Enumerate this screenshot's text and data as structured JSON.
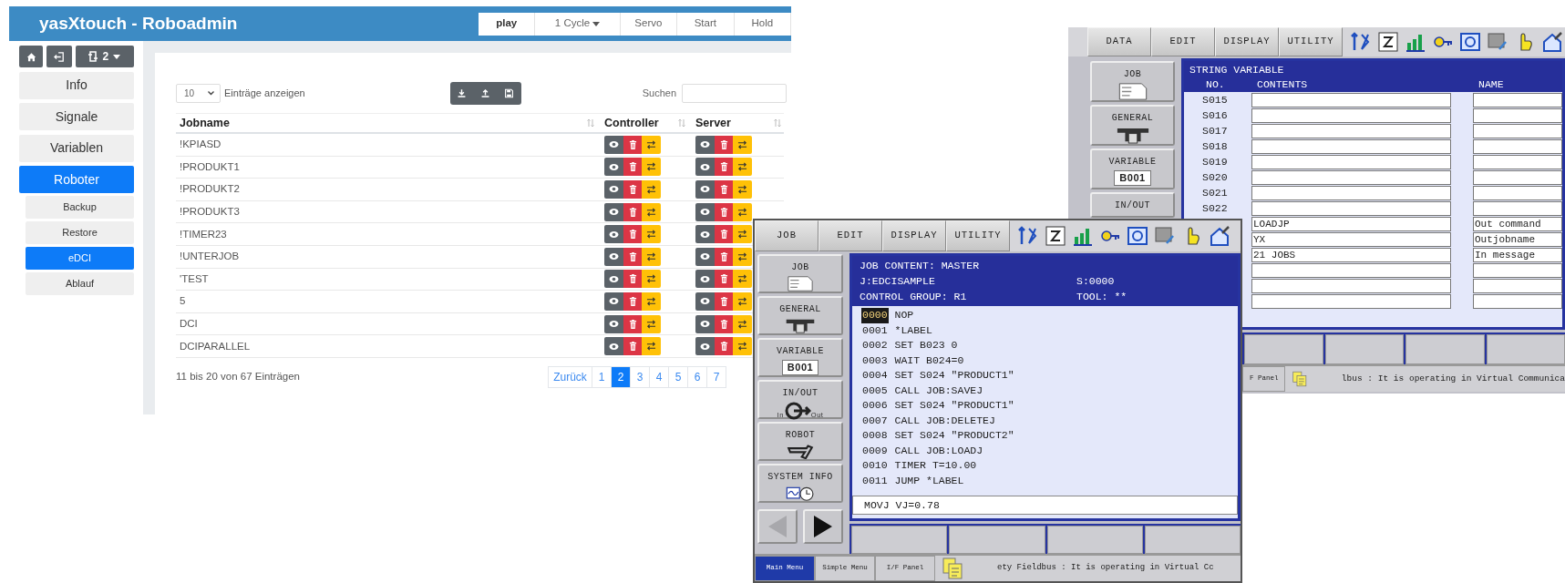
{
  "web_app": {
    "title": "yasXtouch - Roboadmin",
    "header_buttons": [
      {
        "label": "play",
        "selected": true,
        "kind": "button"
      },
      {
        "label": "1 Cycle",
        "selected": false,
        "kind": "dropdown"
      },
      {
        "label": "Servo",
        "selected": false,
        "kind": "button"
      },
      {
        "label": "Start",
        "selected": false,
        "kind": "button"
      },
      {
        "label": "Hold",
        "selected": false,
        "kind": "button"
      }
    ],
    "robot_selector": "2",
    "nav": [
      {
        "label": "Info",
        "selected": false
      },
      {
        "label": "Signale",
        "selected": false
      },
      {
        "label": "Variablen",
        "selected": false
      },
      {
        "label": "Roboter",
        "selected": true,
        "children": [
          {
            "label": "Backup",
            "selected": false
          },
          {
            "label": "Restore",
            "selected": false
          },
          {
            "label": "eDCI",
            "selected": true
          },
          {
            "label": "Ablauf",
            "selected": false
          }
        ]
      }
    ],
    "page_length": {
      "value": "10",
      "label": "Einträge anzeigen"
    },
    "search": {
      "label": "Suchen"
    },
    "columns": [
      "Jobname",
      "Controller",
      "Server"
    ],
    "rows": [
      {
        "jobname": "!KPIASD"
      },
      {
        "jobname": "!PRODUKT1"
      },
      {
        "jobname": "!PRODUKT2"
      },
      {
        "jobname": "!PRODUKT3"
      },
      {
        "jobname": "!TIMER23"
      },
      {
        "jobname": "!UNTERJOB"
      },
      {
        "jobname": "'TEST"
      },
      {
        "jobname": "5"
      },
      {
        "jobname": "DCI"
      },
      {
        "jobname": "DCIPARALLEL"
      }
    ],
    "info": "11 bis 20 von 67 Einträgen",
    "pages": [
      {
        "label": "Zurück",
        "selected": false
      },
      {
        "label": "1",
        "selected": false
      },
      {
        "label": "2",
        "selected": true
      },
      {
        "label": "3",
        "selected": false
      },
      {
        "label": "4",
        "selected": false
      },
      {
        "label": "5",
        "selected": false
      },
      {
        "label": "6",
        "selected": false
      },
      {
        "label": "7",
        "selected": false
      }
    ]
  },
  "pendant_back": {
    "menu": [
      "DATA",
      "EDIT",
      "DISPLAY",
      "UTILITY"
    ],
    "side_buttons": [
      {
        "label": "JOB",
        "kind": "job"
      },
      {
        "label": "GENERAL",
        "kind": "general"
      },
      {
        "label": "VARIABLE",
        "kind": "variable",
        "value": "B001"
      },
      {
        "label": "IN/OUT",
        "kind": "inout"
      }
    ],
    "title": "STRING VARIABLE",
    "columns": [
      "NO.",
      "CONTENTS",
      "NAME"
    ],
    "rows": [
      {
        "number": "S015"
      },
      {
        "number": "S016"
      },
      {
        "number": "S017"
      },
      {
        "number": "S018"
      },
      {
        "number": "S019"
      },
      {
        "number": "S020"
      },
      {
        "number": "S021"
      },
      {
        "number": "S022"
      },
      {
        "contents": "LOADJP",
        "name": "Out command"
      },
      {
        "contents": "YX",
        "name": "Outjobname"
      },
      {
        "contents": "21 JOBS",
        "name": "In message"
      },
      {},
      {},
      {}
    ],
    "status_tabs": [
      {
        "label": "F Panel",
        "selected": false
      }
    ],
    "status_text": "lbus : It is operating in Virtual Communica"
  },
  "pendant_front": {
    "menu": [
      "JOB",
      "EDIT",
      "DISPLAY",
      "UTILITY"
    ],
    "side_buttons": [
      {
        "label": "JOB",
        "kind": "job"
      },
      {
        "label": "GENERAL",
        "kind": "general"
      },
      {
        "label": "VARIABLE",
        "kind": "variable",
        "value": "B001"
      },
      {
        "label": "IN/OUT",
        "kind": "inout",
        "in_label": "In",
        "out_label": "Out"
      },
      {
        "label": "ROBOT",
        "kind": "robot"
      },
      {
        "label": "SYSTEM INFO",
        "kind": "sysinfo"
      }
    ],
    "arrows": {
      "back_enabled": false,
      "forward_enabled": true
    },
    "header": [
      {
        "left": "JOB CONTENT: MASTER"
      },
      {
        "left": "J:EDCISAMPLE",
        "right": "S:0000"
      },
      {
        "left": "CONTROL GROUP: R1",
        "right": "TOOL: **"
      }
    ],
    "lines": [
      {
        "number": "0000",
        "text": "NOP",
        "selected": true
      },
      {
        "number": "0001",
        "text": "*LABEL",
        "selected": false
      },
      {
        "number": "0002",
        "text": "SET B023 0",
        "selected": false
      },
      {
        "number": "0003",
        "text": "WAIT B024=0",
        "selected": false
      },
      {
        "number": "0004",
        "text": "SET S024 \"PRODUCT1\"",
        "selected": false
      },
      {
        "number": "0005",
        "text": "CALL JOB:SAVEJ",
        "selected": false
      },
      {
        "number": "0006",
        "text": "SET S024 \"PRODUCT1\"",
        "selected": false
      },
      {
        "number": "0007",
        "text": "CALL JOB:DELETEJ",
        "selected": false
      },
      {
        "number": "0008",
        "text": "SET S024 \"PRODUCT2\"",
        "selected": false
      },
      {
        "number": "0009",
        "text": "CALL JOB:LOADJ",
        "selected": false
      },
      {
        "number": "0010",
        "text": "TIMER T=10.00",
        "selected": false
      },
      {
        "number": "0011",
        "text": "JUMP *LABEL",
        "selected": false
      }
    ],
    "input_line": "MOVJ VJ=0.78",
    "status_tabs": [
      {
        "label": "Main Menu",
        "selected": true
      },
      {
        "label": "Simple Menu",
        "selected": false
      },
      {
        "label": "I/F Panel",
        "selected": false
      }
    ],
    "status_text": "ety Fieldbus : It is operating in Virtual Cc"
  }
}
